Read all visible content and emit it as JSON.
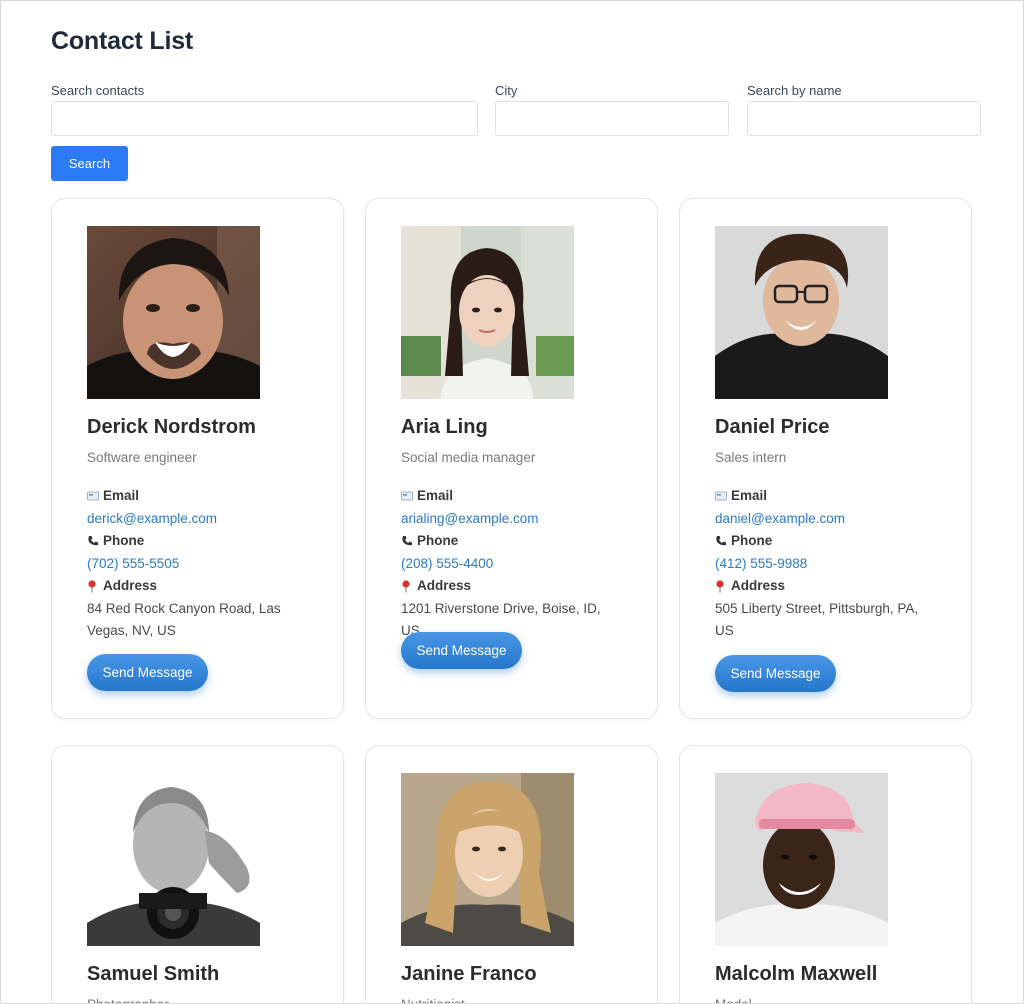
{
  "page_title": "Contact List",
  "search": {
    "contacts_label": "Search contacts",
    "city_label": "City",
    "name_label": "Search by name",
    "contacts_value": "",
    "city_value": "",
    "name_value": "",
    "button_label": "Search"
  },
  "labels": {
    "email": "Email",
    "phone": "Phone",
    "address": "Address",
    "send": "Send Message"
  },
  "contacts": [
    {
      "name": "Derick Nordstrom",
      "role": "Software engineer",
      "email": "derick@example.com",
      "phone": "(702) 555-5505",
      "address": "84 Red Rock Canyon Road, Las Vegas, NV, US"
    },
    {
      "name": "Aria Ling",
      "role": "Social media manager",
      "email": "arialing@example.com",
      "phone": "(208) 555-4400",
      "address": "1201 Riverstone Drive, Boise, ID, US"
    },
    {
      "name": "Daniel Price",
      "role": "Sales intern",
      "email": "daniel@example.com",
      "phone": "(412) 555-9988",
      "address": "505 Liberty Street, Pittsburgh, PA, US"
    },
    {
      "name": "Samuel Smith",
      "role": "Photographer"
    },
    {
      "name": "Janine Franco",
      "role": "Nutritionist"
    },
    {
      "name": "Malcolm Maxwell",
      "role": "Model"
    }
  ],
  "colors": {
    "accent": "#2b7bf4",
    "link": "#2c7ac0",
    "send_button": "#2f82d6"
  }
}
